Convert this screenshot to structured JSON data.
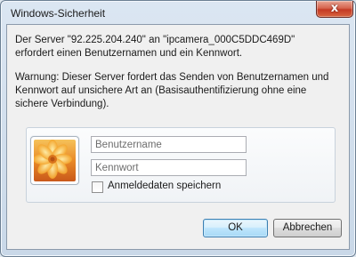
{
  "window": {
    "title": "Windows-Sicherheit"
  },
  "close_button": {
    "glyph": "x"
  },
  "message": {
    "line1": "Der Server \"92.225.204.240\" an \"ipcamera_000C5DDC469D\" erfordert einen Benutzernamen und ein Kennwort.",
    "warning": "Warnung: Dieser Server fordert das Senden von Benutzernamen und Kennwort auf unsichere Art an (Basisauthentifizierung ohne eine sichere Verbindung)."
  },
  "credentials": {
    "avatar_icon": "user-tile-flower-icon",
    "username_placeholder": "Benutzername",
    "username_value": "",
    "password_placeholder": "Kennwort",
    "password_value": "",
    "remember_label": "Anmeldedaten speichern",
    "remember_checked": false
  },
  "buttons": {
    "ok": "OK",
    "cancel": "Abbrechen"
  },
  "colors": {
    "ok_border": "#3c7fb1",
    "close_red": "#c43a25",
    "frame_blue": "#c9d8e8"
  }
}
